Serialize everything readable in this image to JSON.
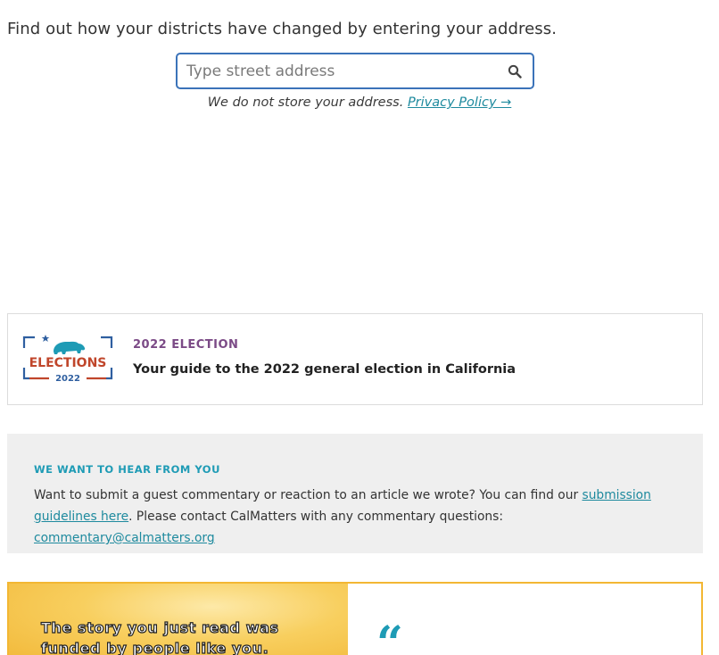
{
  "lookup": {
    "intro": "Find out how your districts have changed by entering your address.",
    "placeholder": "Type street address",
    "privacy_prefix": "We do not store your address.",
    "privacy_link": "Privacy Policy →"
  },
  "election_card": {
    "logo_text": "ELECTIONS",
    "logo_year": "2022",
    "kicker": "2022 ELECTION",
    "title": "Your guide to the 2022 general election in California"
  },
  "hear_from_you": {
    "heading": "WE WANT TO HEAR FROM YOU",
    "text_1": "Want to submit a guest commentary or reaction to an article we wrote? You can find our ",
    "link_1": "submission guidelines here",
    "text_2": ". Please contact CalMatters with any commentary questions: ",
    "link_2": "commentary@calmatters.org"
  },
  "promo": {
    "line_1": "The story you just read was",
    "line_2": "funded by people like you.",
    "quote_mark": "“"
  },
  "colors": {
    "accent_teal": "#1e9bb5",
    "link": "#1e8a9e",
    "kicker_purple": "#7b4a86",
    "input_border": "#3b73b9",
    "logo_red": "#c0462b",
    "logo_blue": "#2f5fa0",
    "promo_gold": "#f3b733"
  },
  "icons": {
    "search": "search-icon",
    "bear": "bear-icon",
    "star": "star-icon",
    "quote": "quote-icon"
  }
}
